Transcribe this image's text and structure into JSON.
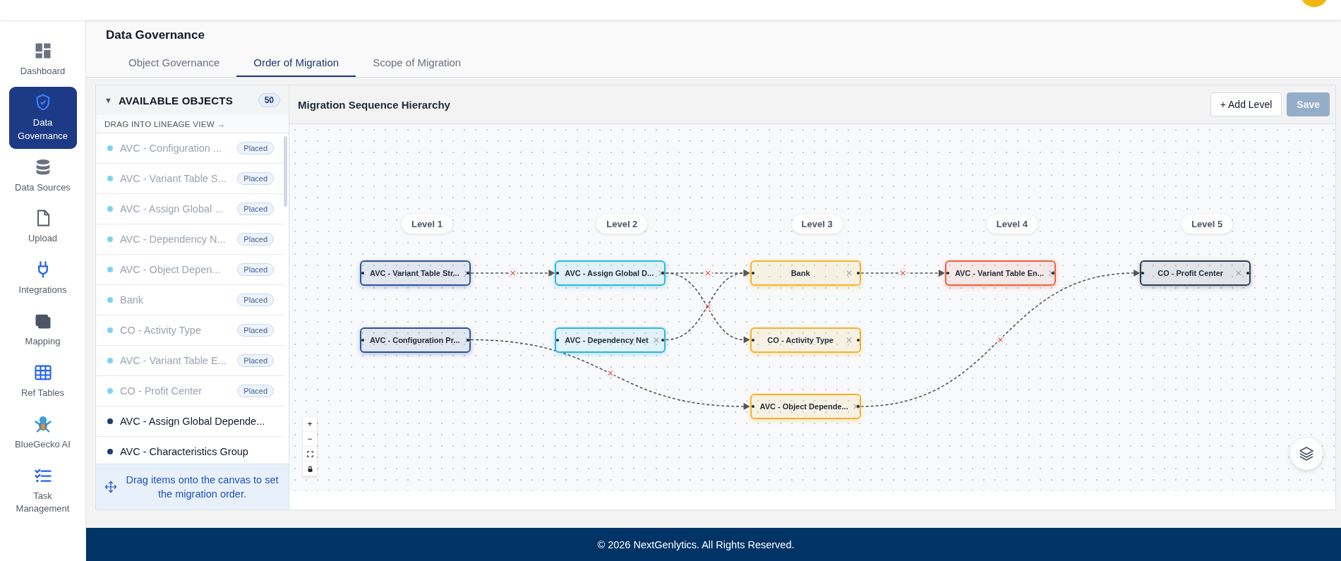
{
  "sidebar": {
    "items": [
      {
        "label": "Dashboard",
        "kind": "dashboard",
        "selected": false
      },
      {
        "label": "Data Governance",
        "kind": "shield",
        "selected": true
      },
      {
        "label": "Data Sources",
        "kind": "database",
        "selected": false
      },
      {
        "label": "Upload",
        "kind": "file",
        "selected": false
      },
      {
        "label": "Integrations",
        "kind": "plug",
        "selected": false
      },
      {
        "label": "Mapping",
        "kind": "mapping",
        "selected": false
      },
      {
        "label": "Ref Tables",
        "kind": "table",
        "selected": false
      },
      {
        "label": "BlueGecko AI",
        "kind": "gecko",
        "selected": false
      },
      {
        "label": "Task Management",
        "kind": "tasks",
        "selected": false
      }
    ]
  },
  "header": {
    "title": "Data Governance"
  },
  "tabs": [
    {
      "label": "Object Governance",
      "selected": false
    },
    {
      "label": "Order of Migration",
      "selected": true
    },
    {
      "label": "Scope of Migration",
      "selected": false
    }
  ],
  "objects_panel": {
    "toggle": "▼",
    "title": "AVAILABLE OBJECTS",
    "count": "50",
    "hint": "DRAG INTO LINEAGE VIEW →",
    "items": [
      {
        "name": "AVC - Configuration ...",
        "placed": true,
        "badge": "Placed"
      },
      {
        "name": "AVC - Variant Table S...",
        "placed": true,
        "badge": "Placed"
      },
      {
        "name": "AVC - Assign Global ...",
        "placed": true,
        "badge": "Placed"
      },
      {
        "name": "AVC - Dependency N...",
        "placed": true,
        "badge": "Placed"
      },
      {
        "name": "AVC - Object Depen...",
        "placed": true,
        "badge": "Placed"
      },
      {
        "name": "Bank",
        "placed": true,
        "badge": "Placed"
      },
      {
        "name": "CO - Activity Type",
        "placed": true,
        "badge": "Placed"
      },
      {
        "name": "AVC - Variant Table E...",
        "placed": true,
        "badge": "Placed"
      },
      {
        "name": "CO - Profit Center",
        "placed": true,
        "badge": "Placed"
      },
      {
        "name": "AVC - Assign Global Depende...",
        "placed": false
      },
      {
        "name": "AVC - Characteristics Group",
        "placed": false
      }
    ],
    "note": "Drag items onto the canvas to set the migration order."
  },
  "canvas": {
    "title": "Migration Sequence Hierarchy",
    "buttons": [
      {
        "label": "+ Add Level",
        "disabled": false
      },
      {
        "label": "Save",
        "disabled": true
      }
    ],
    "levels": [
      {
        "label": "Level 1",
        "nodes": [
          {
            "name": "AVC - Variant Table Str...",
            "color": "#2b5597",
            "links_to": {
              "L2N1": true
            }
          },
          {
            "name": "AVC - Configuration Pr...",
            "color": "#2b5597",
            "links_to": {
              "L3N3": true
            }
          }
        ]
      },
      {
        "label": "Level 2",
        "nodes": [
          {
            "name": "AVC - Assign Global D...",
            "color": "#29b6e6",
            "links_to": {
              "L3N1": true,
              "L3N2": true
            }
          },
          {
            "name": "AVC - Dependency Net",
            "color": "#29b6e6",
            "links_to": {
              "L3N1": true
            }
          }
        ]
      },
      {
        "label": "Level 3",
        "nodes": [
          {
            "name": "Bank",
            "color": "#f5b32a",
            "links_to": {
              "L4N1": true
            }
          },
          {
            "name": "CO - Activity Type",
            "color": "#f5b32a"
          },
          {
            "name": "AVC - Object Depende...",
            "color": "#f5b32a",
            "links_to": {
              "L5N1": true
            }
          }
        ]
      },
      {
        "label": "Level 4",
        "nodes": [
          {
            "name": "AVC - Variant Table En...",
            "color": "#f0603e"
          }
        ]
      },
      {
        "label": "Level 5",
        "nodes": [
          {
            "name": "CO - Profit Center",
            "color": "#2c3e50"
          }
        ]
      }
    ],
    "zoom_controls": [
      {
        "kind": "text",
        "symbol": "+"
      },
      {
        "kind": "text",
        "symbol": "−"
      },
      {
        "kind": "fit"
      },
      {
        "kind": "lock"
      }
    ]
  },
  "footer": {
    "text": "© 2026 NextGenlytics. All Rights Reserved."
  }
}
